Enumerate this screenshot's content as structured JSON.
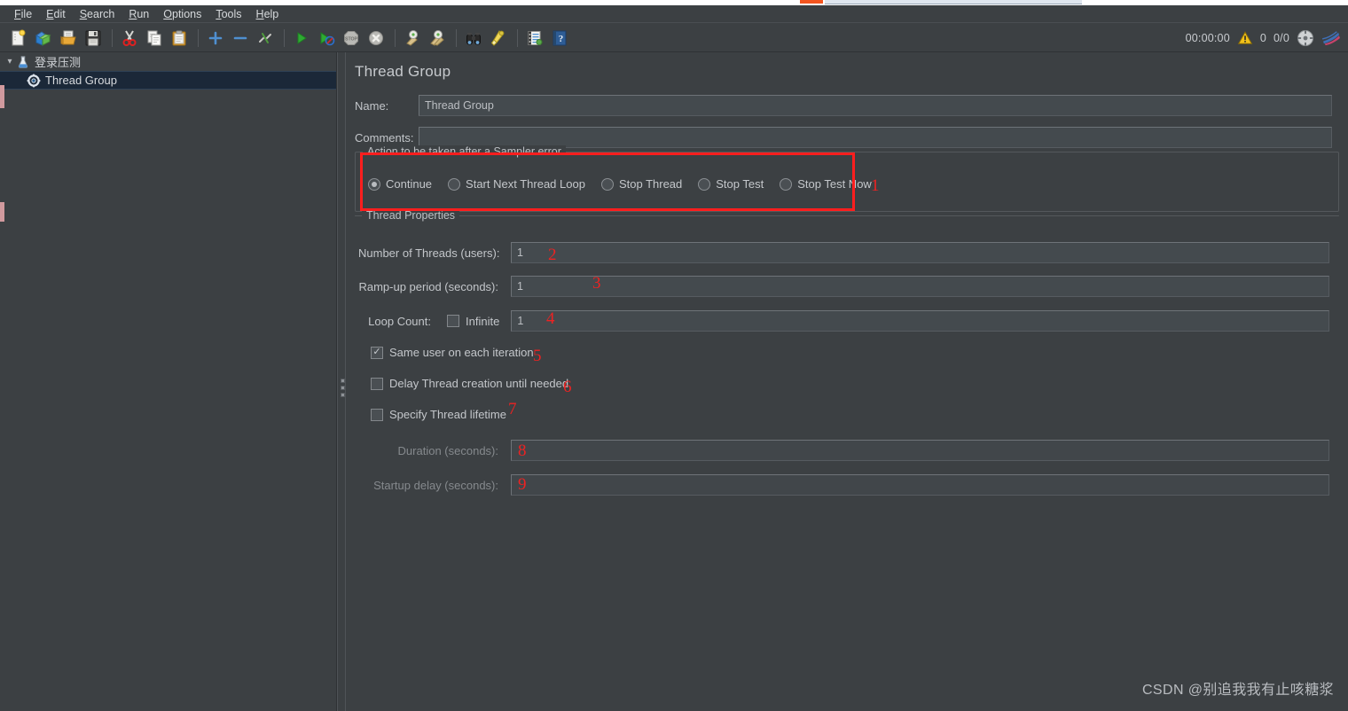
{
  "app": {
    "title": "Thread Group",
    "watermark": "CSDN @别追我我有止咳糖浆"
  },
  "menubar": {
    "items": [
      {
        "label": "File",
        "mnemonic": "F"
      },
      {
        "label": "Edit",
        "mnemonic": "E"
      },
      {
        "label": "Search",
        "mnemonic": "S"
      },
      {
        "label": "Run",
        "mnemonic": "R"
      },
      {
        "label": "Options",
        "mnemonic": "O"
      },
      {
        "label": "Tools",
        "mnemonic": "T"
      },
      {
        "label": "Help",
        "mnemonic": "H"
      }
    ]
  },
  "toolbar": {
    "buttons": [
      {
        "name": "new-icon",
        "tip": "New"
      },
      {
        "name": "templates-icon",
        "tip": "Templates"
      },
      {
        "name": "open-icon",
        "tip": "Open"
      },
      {
        "name": "save-icon",
        "tip": "Save Test Plan"
      },
      {
        "name": "cut-icon",
        "tip": "Cut"
      },
      {
        "name": "copy-icon",
        "tip": "Copy"
      },
      {
        "name": "paste-icon",
        "tip": "Paste"
      },
      {
        "name": "expand-icon",
        "tip": "Expand All"
      },
      {
        "name": "collapse-icon",
        "tip": "Collapse All"
      },
      {
        "name": "toggle-icon",
        "tip": "Toggle"
      },
      {
        "name": "start-icon",
        "tip": "Start"
      },
      {
        "name": "start-no-pauses-icon",
        "tip": "Start no pauses"
      },
      {
        "name": "stop-icon",
        "tip": "Stop"
      },
      {
        "name": "shutdown-icon",
        "tip": "Shutdown"
      },
      {
        "name": "clear-icon",
        "tip": "Clear"
      },
      {
        "name": "clear-all-icon",
        "tip": "Clear All"
      },
      {
        "name": "search-binoculars-icon",
        "tip": "Search"
      },
      {
        "name": "reset-search-icon",
        "tip": "Reset Search"
      },
      {
        "name": "function-helper-icon",
        "tip": "Function Helper Dialog"
      },
      {
        "name": "help-icon",
        "tip": "Help"
      }
    ],
    "status": {
      "elapsed": "00:00:00",
      "warning_count": "0",
      "threads": "0/0"
    }
  },
  "tree": {
    "root": {
      "label": "登录压测",
      "icon": "test-plan-icon",
      "expanded": true
    },
    "children": [
      {
        "label": "Thread Group",
        "icon": "thread-group-icon",
        "selected": true
      }
    ]
  },
  "form": {
    "name_label": "Name:",
    "name_value": "Thread Group",
    "comments_label": "Comments:",
    "comments_value": ""
  },
  "sampler_error": {
    "group_title": "Action to be taken after a Sampler error",
    "options": [
      {
        "label": "Continue",
        "checked": true
      },
      {
        "label": "Start Next Thread Loop",
        "checked": false
      },
      {
        "label": "Stop Thread",
        "checked": false
      },
      {
        "label": "Stop Test",
        "checked": false
      },
      {
        "label": "Stop Test Now",
        "checked": false
      }
    ]
  },
  "thread_properties": {
    "group_title": "Thread Properties",
    "num_threads_label": "Number of Threads (users):",
    "num_threads_value": "1",
    "ramp_up_label": "Ramp-up period (seconds):",
    "ramp_up_value": "1",
    "loop_count_label": "Loop Count:",
    "infinite_label": "Infinite",
    "infinite_checked": false,
    "loop_count_value": "1",
    "same_user_label": "Same user on each iteration",
    "same_user_checked": true,
    "delay_thread_label": "Delay Thread creation until needed",
    "delay_thread_checked": false,
    "specify_lifetime_label": "Specify Thread lifetime",
    "specify_lifetime_checked": false,
    "duration_label": "Duration (seconds):",
    "duration_value": "",
    "duration_enabled": false,
    "startup_delay_label": "Startup delay (seconds):",
    "startup_delay_value": "",
    "startup_delay_enabled": false
  },
  "annotations": {
    "n1": "1",
    "n2": "2",
    "n3": "3",
    "n4": "4",
    "n5": "5",
    "n6": "6",
    "n7": "7",
    "n8": "8",
    "n9": "9"
  },
  "colors": {
    "background": "#3c4043",
    "annotation_red": "#ff1e1e",
    "selection_blue": "#1b2838",
    "text": "#c9ccd0"
  }
}
